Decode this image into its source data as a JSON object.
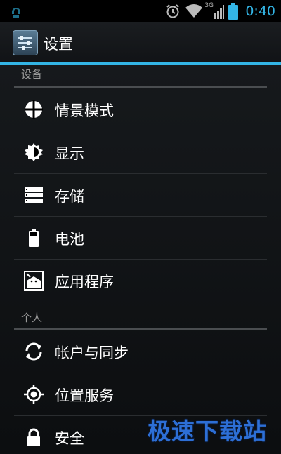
{
  "status_bar": {
    "time": "0:40",
    "network_type": "3G",
    "icons": [
      "notification-icon",
      "alarm-icon",
      "wifi-icon",
      "signal-icon",
      "battery-icon"
    ]
  },
  "action_bar": {
    "title": "设置",
    "icon": "settings-app-icon"
  },
  "sections": [
    {
      "header": "设备",
      "items": [
        {
          "label": "情景模式",
          "icon": "profiles-icon"
        },
        {
          "label": "显示",
          "icon": "display-icon"
        },
        {
          "label": "存储",
          "icon": "storage-icon"
        },
        {
          "label": "电池",
          "icon": "battery-icon"
        },
        {
          "label": "应用程序",
          "icon": "apps-icon"
        }
      ]
    },
    {
      "header": "个人",
      "items": [
        {
          "label": "帐户与同步",
          "icon": "sync-icon"
        },
        {
          "label": "位置服务",
          "icon": "location-icon"
        },
        {
          "label": "安全",
          "icon": "lock-icon"
        }
      ]
    }
  ],
  "watermark": "极速下载站",
  "colors": {
    "accent": "#33b5e5",
    "watermark": "#2d6fd6"
  }
}
